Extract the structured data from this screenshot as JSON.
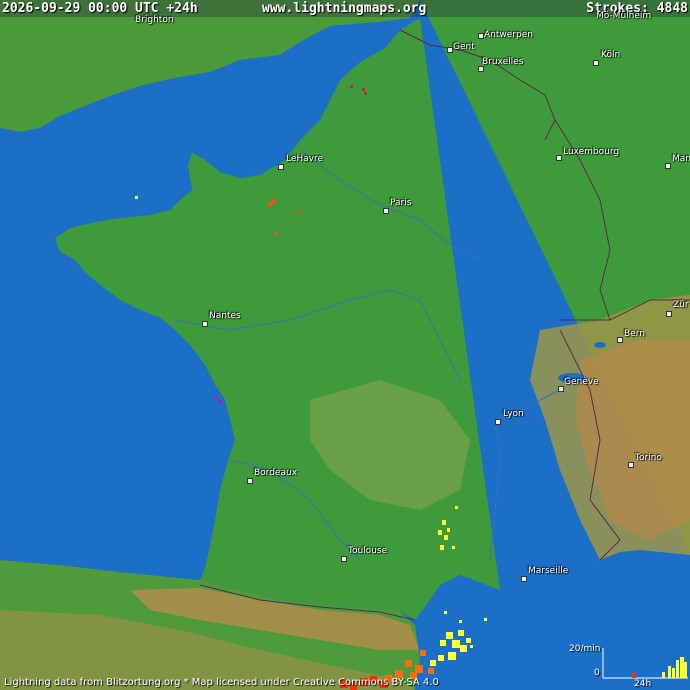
{
  "header": {
    "datetime": "2026-09-29 00:00 UTC +24h",
    "site": "www.lightningmaps.org",
    "strokes_label": "Strokes: 4848"
  },
  "cities": [
    {
      "key": "gent",
      "label": "Gent"
    },
    {
      "key": "antwerpen",
      "label": "Antwerpen"
    },
    {
      "key": "bruxelles",
      "label": "Bruxelles"
    },
    {
      "key": "koln",
      "label": "Köln"
    },
    {
      "key": "luxembourg",
      "label": "Luxembourg"
    },
    {
      "key": "lehavre",
      "label": "LeHavre"
    },
    {
      "key": "paris",
      "label": "Paris"
    },
    {
      "key": "nantes",
      "label": "Nantes"
    },
    {
      "key": "bern",
      "label": "Bern"
    },
    {
      "key": "geneve",
      "label": "Genève"
    },
    {
      "key": "lyon",
      "label": "Lyon"
    },
    {
      "key": "bordeaux",
      "label": "Bordeaux"
    },
    {
      "key": "torino",
      "label": "Torino"
    },
    {
      "key": "toulouse",
      "label": "Toulouse"
    },
    {
      "key": "marseille",
      "label": "Marseille"
    },
    {
      "key": "mannheim",
      "label": "Mann"
    },
    {
      "key": "zurich",
      "label": "Zür"
    },
    {
      "key": "moenchen",
      "label": "Mö-Mülheim"
    },
    {
      "key": "brighton",
      "label": "Brighton"
    }
  ],
  "chart": {
    "y_label": "20/min",
    "zero_label": "0",
    "x_label": "24h"
  },
  "credit": "Lightning data from Blitzortung.org  *  Map licensed under Creative Commons BY-SA 4.0",
  "colors": {
    "sea": "#1b6fc6",
    "land": "#3f9a3c",
    "uplands": "#7fa64a",
    "mountains": "#b08c4a",
    "strike_recent": "#ffff33",
    "strike_old": "#ff2a00"
  }
}
